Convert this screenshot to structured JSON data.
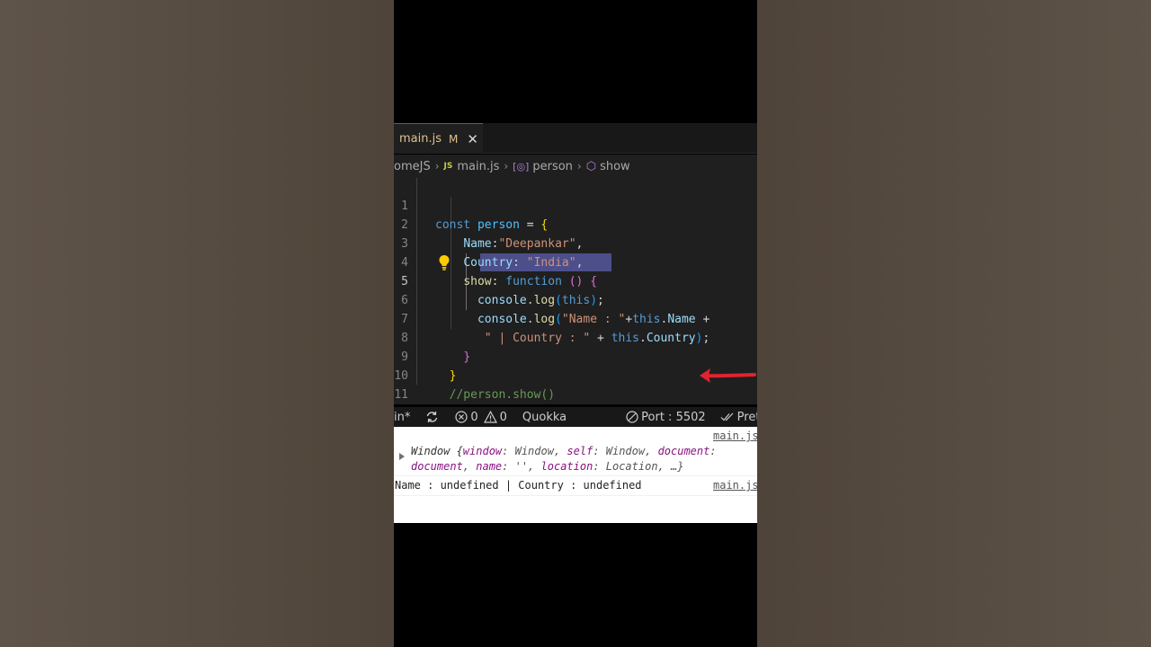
{
  "tab": {
    "filename": "main.js",
    "modified": "M",
    "close": "✕"
  },
  "breadcrumb": {
    "folder": "omeJS",
    "js_badge": "JS",
    "file": "main.js",
    "symbol": "person",
    "method": "show"
  },
  "editor": {
    "lines": [
      "1",
      "2",
      "3",
      "4",
      "5",
      "6",
      "7",
      "8",
      "9",
      "10",
      "11"
    ],
    "active_line": "5"
  },
  "statusbar": {
    "branch": "in*",
    "errors": "0",
    "warnings": "0",
    "quokka": "Quokka",
    "port": "Port : 5502",
    "prettier": "Pret"
  },
  "console": {
    "source": "main.js",
    "source2": "main.js",
    "row1_prefix": "Window {",
    "row1_k1": "window",
    "row1_v1": ": Window, ",
    "row1_k2": "self",
    "row1_v2": ": Window, ",
    "row1_k3": "document",
    "row1_v3": ":",
    "row1_k4": "document",
    "row1_v4": ", ",
    "row1_k5": "name",
    "row1_v5": ": '', ",
    "row1_k6": "location",
    "row1_v6": ": Location, …}",
    "row2": "Name : undefined | Country : undefined"
  },
  "colors": {
    "arrow": "#e0242f",
    "accent": "#0078d4"
  }
}
